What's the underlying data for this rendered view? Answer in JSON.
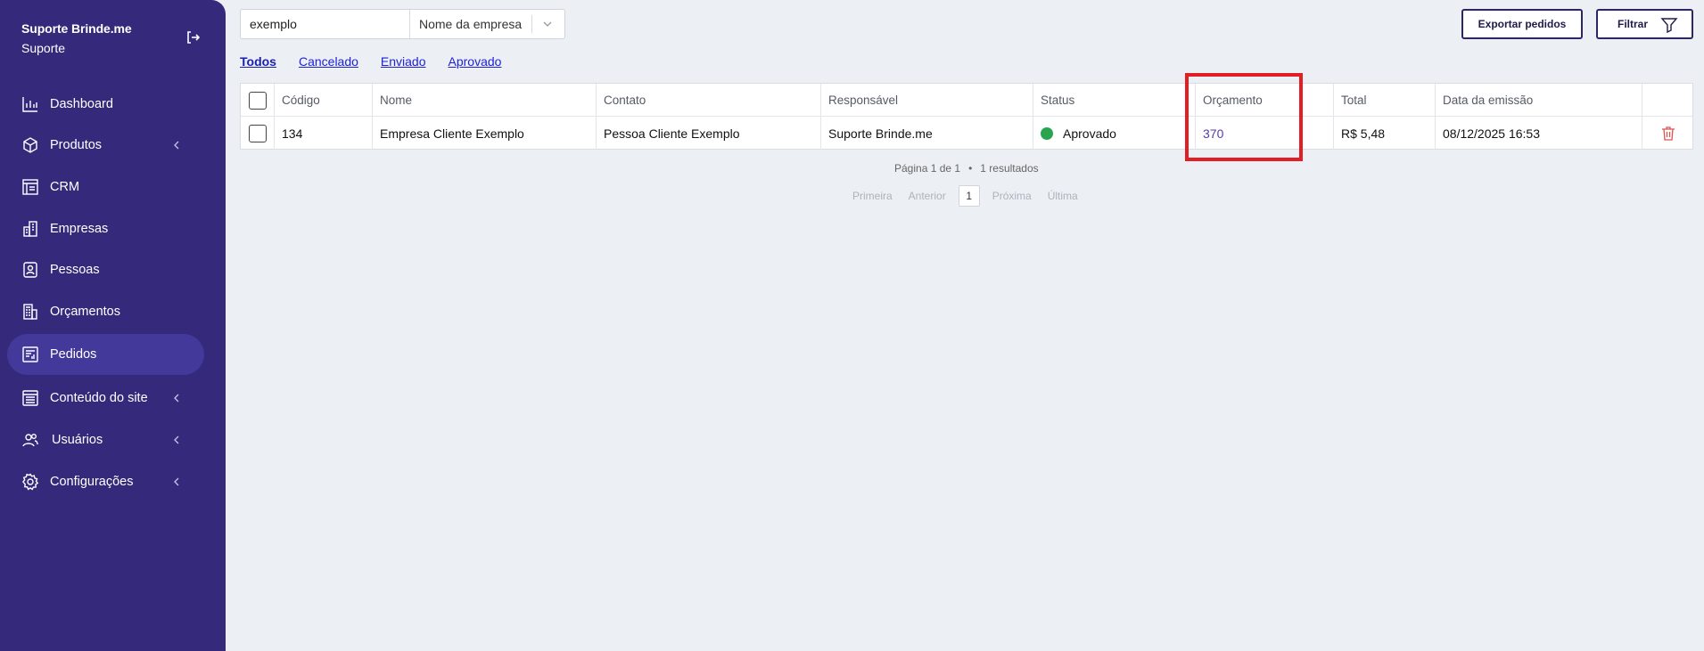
{
  "sidebar": {
    "brand_name": "Suporte Brinde.me",
    "brand_role": "Suporte",
    "items": [
      {
        "label": "Dashboard",
        "icon": "chart-bars-icon",
        "chevron": false
      },
      {
        "label": "Produtos",
        "icon": "box-icon",
        "chevron": true
      },
      {
        "label": "CRM",
        "icon": "crm-board-icon",
        "chevron": false
      },
      {
        "label": "Empresas",
        "icon": "buildings-icon",
        "chevron": false
      },
      {
        "label": "Pessoas",
        "icon": "contact-card-icon",
        "chevron": false
      },
      {
        "label": "Orçamentos",
        "icon": "calculator-building-icon",
        "chevron": false
      },
      {
        "label": "Pedidos",
        "icon": "order-document-icon",
        "chevron": false,
        "active": true
      },
      {
        "label": "Conteúdo do site",
        "icon": "website-content-icon",
        "chevron": true
      },
      {
        "label": "Usuários",
        "icon": "users-icon",
        "chevron": true
      },
      {
        "label": "Configurações",
        "icon": "gear-icon",
        "chevron": true
      }
    ]
  },
  "search": {
    "value": "exemplo",
    "filter_field": "Nome da empresa"
  },
  "buttons": {
    "export": "Exportar pedidos",
    "filter": "Filtrar"
  },
  "tabs": [
    {
      "label": "Todos",
      "active": true
    },
    {
      "label": "Cancelado"
    },
    {
      "label": "Enviado"
    },
    {
      "label": "Aprovado"
    }
  ],
  "table": {
    "columns": [
      "Código",
      "Nome",
      "Contato",
      "Responsável",
      "Status",
      "Orçamento",
      "Total",
      "Data da emissão"
    ],
    "rows": [
      {
        "codigo": "134",
        "nome": "Empresa Cliente Exemplo",
        "contato": "Pessoa Cliente Exemplo",
        "responsavel": "Suporte Brinde.me",
        "status": "Aprovado",
        "status_color": "#2aa44f",
        "orcamento": "370",
        "total": "R$ 5,48",
        "data": "08/12/2025 16:53"
      }
    ]
  },
  "pagination": {
    "page_info": "Página 1 de 1",
    "results": "1 resultados",
    "first": "Primeira",
    "prev": "Anterior",
    "current": "1",
    "next": "Próxima",
    "last": "Última"
  },
  "colors": {
    "sidebar": "#34297a",
    "highlight": "#e21d24",
    "link": "#1f22d6"
  }
}
